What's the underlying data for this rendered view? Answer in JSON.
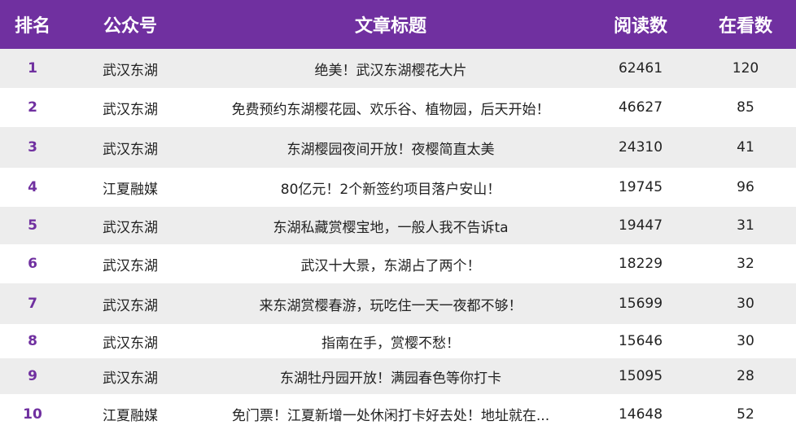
{
  "header": {
    "rank": "排名",
    "account": "公众号",
    "title": "文章标题",
    "reads": "阅读数",
    "views": "在看数"
  },
  "rows": [
    {
      "rank": "1",
      "account": "武汉东湖",
      "title": "绝美！武汉东湖樱花大片",
      "reads": "62461",
      "views": "120"
    },
    {
      "rank": "2",
      "account": "武汉东湖",
      "title": "免费预约东湖樱花园、欢乐谷、植物园，后天开始！",
      "reads": "46627",
      "views": "85"
    },
    {
      "rank": "3",
      "account": "武汉东湖",
      "title": "东湖樱园夜间开放！夜樱简直太美",
      "reads": "24310",
      "views": "41"
    },
    {
      "rank": "4",
      "account": "江夏融媒",
      "title": "80亿元！2个新签约项目落户安山！",
      "reads": "19745",
      "views": "96"
    },
    {
      "rank": "5",
      "account": "武汉东湖",
      "title": "东湖私藏赏樱宝地，一般人我不告诉ta",
      "reads": "19447",
      "views": "31"
    },
    {
      "rank": "6",
      "account": "武汉东湖",
      "title": "武汉十大景，东湖占了两个！",
      "reads": "18229",
      "views": "32"
    },
    {
      "rank": "7",
      "account": "武汉东湖",
      "title": "来东湖赏樱春游，玩吃住一天一夜都不够！",
      "reads": "15699",
      "views": "30"
    },
    {
      "rank": "8",
      "account": "武汉东湖",
      "title": "指南在手，赏樱不愁！",
      "reads": "15646",
      "views": "30"
    },
    {
      "rank": "9",
      "account": "武汉东湖",
      "title": "东湖牡丹园开放！满园春色等你打卡",
      "reads": "15095",
      "views": "28"
    },
    {
      "rank": "10",
      "account": "江夏融媒",
      "title": "免门票！江夏新增一处休闲打卡好去处！地址就在...",
      "reads": "14648",
      "views": "52"
    }
  ],
  "colors": {
    "header_bg": "#7030a0",
    "header_text": "#ffffff",
    "rank_text": "#7030a0",
    "shaded_row": "#ededed",
    "plain_row": "#ffffff"
  }
}
